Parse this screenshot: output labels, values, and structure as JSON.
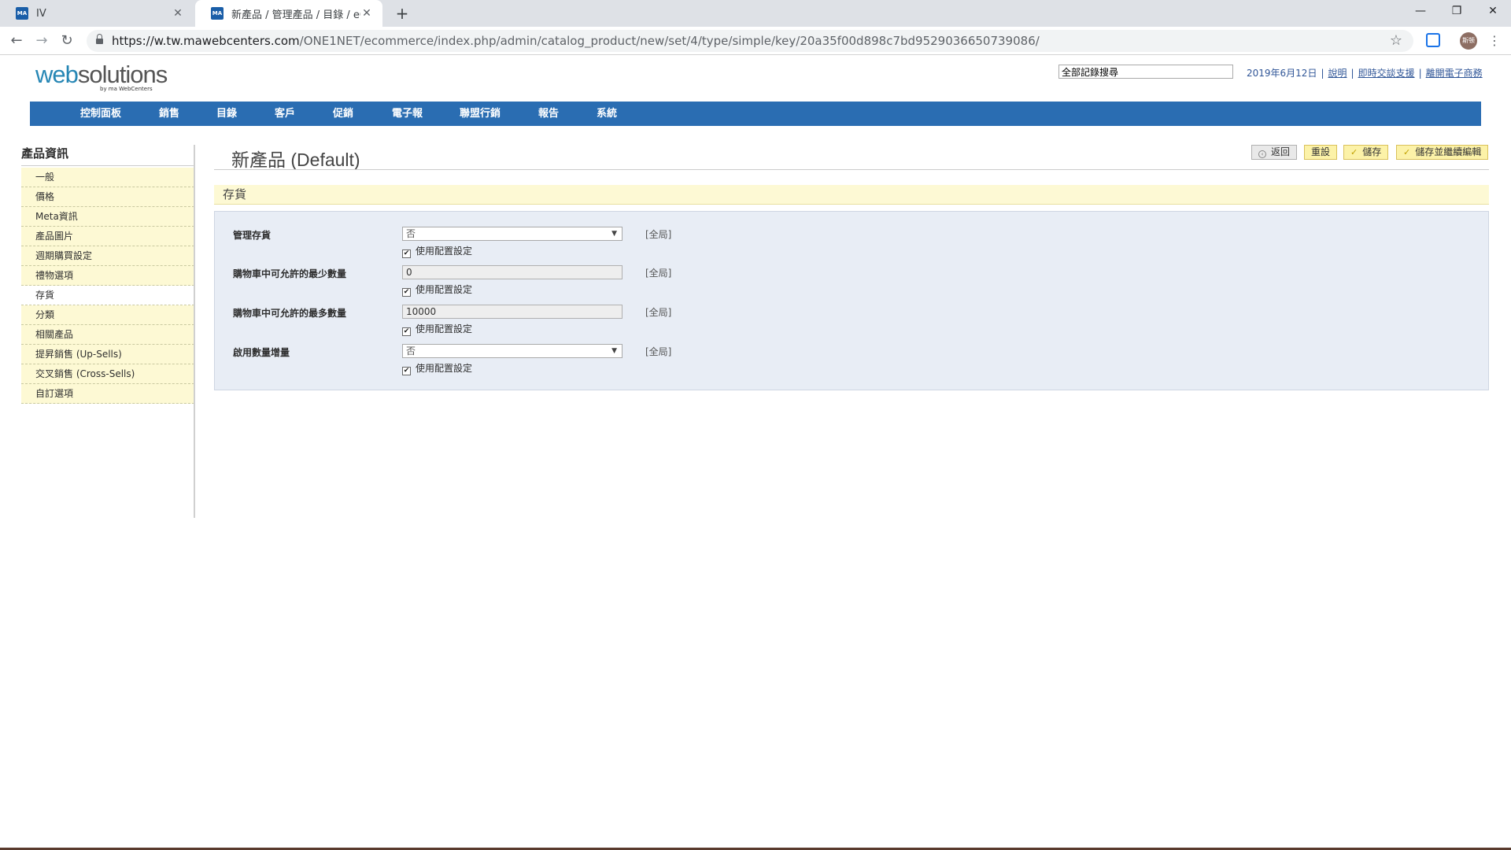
{
  "browser": {
    "tabs": [
      {
        "title": "IV",
        "favicon": "MA"
      },
      {
        "title": "新產品 / 管理產品 / 目錄 / eCom",
        "favicon": "MA"
      }
    ],
    "url_host": "https://w.tw.mawebcenters.com",
    "url_path": "/ONE1NET/ecommerce/index.php/admin/catalog_product/new/set/4/type/simple/key/20a35f00d898c7bd9529036650739086/",
    "avatar_text": "斯顿"
  },
  "header": {
    "logo_web": "web",
    "logo_solutions": "solutions",
    "logo_byline": "by ma WebCenters",
    "search_value": "全部記錄搜尋",
    "date": "2019年6月12日",
    "links": [
      "說明",
      "即時交談支援",
      "離開電子商務"
    ]
  },
  "nav": [
    "控制面板",
    "銷售",
    "目錄",
    "客戶",
    "促銷",
    "電子報",
    "聯盟行銷",
    "報告",
    "系統"
  ],
  "sidebar": {
    "title": "產品資訊",
    "items": [
      "一般",
      "價格",
      "Meta資訊",
      "產品圖片",
      "週期購買設定",
      "禮物選項",
      "存貨",
      "分類",
      "相關產品",
      "提昇銷售 (Up-Sells)",
      "交叉銷售 (Cross-Sells)",
      "自訂選項"
    ],
    "active_index": 6
  },
  "page": {
    "title": "新產品 (Default)",
    "buttons": {
      "back": "返回",
      "reset": "重設",
      "save": "儲存",
      "save_continue": "儲存並繼續編輯"
    },
    "section_title": "存貨",
    "fields": [
      {
        "label": "管理存貨",
        "type": "select",
        "value": "否",
        "scope": "[全局]",
        "checkbox": "使用配置設定",
        "checked": true
      },
      {
        "label": "購物車中可允許的最少數量",
        "type": "input",
        "value": "0",
        "scope": "[全局]",
        "checkbox": "使用配置設定",
        "checked": true
      },
      {
        "label": "購物車中可允許的最多數量",
        "type": "input",
        "value": "10000",
        "scope": "[全局]",
        "checkbox": "使用配置設定",
        "checked": true
      },
      {
        "label": "啟用數量增量",
        "type": "select",
        "value": "否",
        "scope": "[全局]",
        "checkbox": "使用配置設定",
        "checked": true
      }
    ]
  },
  "colors": {
    "nav_blue": "#2a6db2",
    "tab_yellow": "#fdf9d4",
    "fieldset_bg": "#e8edf5",
    "link_blue": "#2f5597"
  }
}
